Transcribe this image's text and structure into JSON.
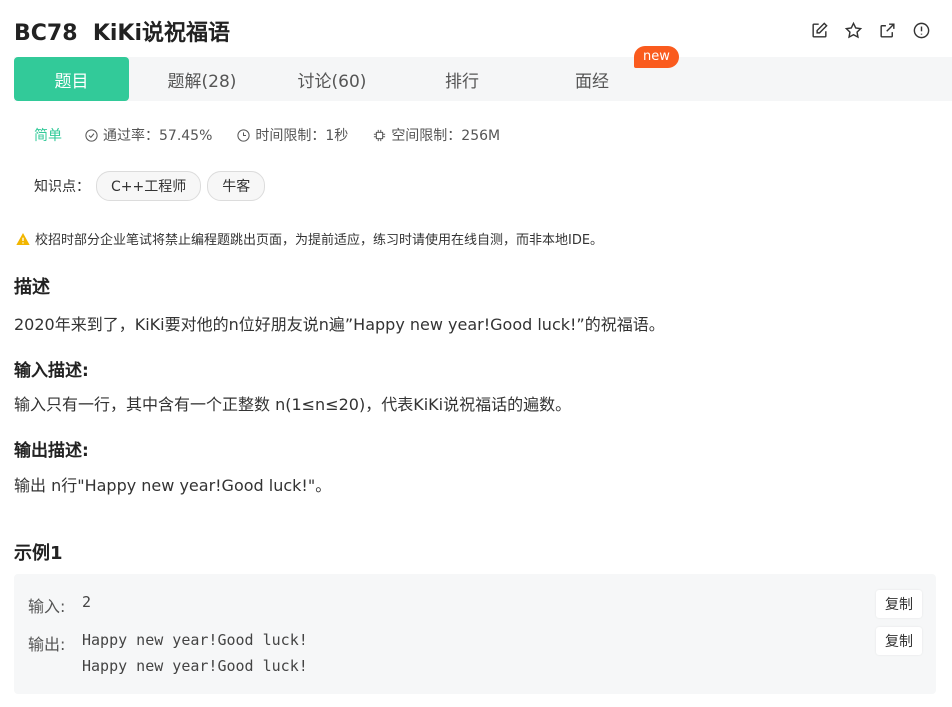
{
  "problem": {
    "id": "BC78",
    "name": "KiKi说祝福语",
    "title_full": "BC78  KiKi说祝福语"
  },
  "title_actions": [
    {
      "icon": "edit-icon"
    },
    {
      "icon": "star-icon"
    },
    {
      "icon": "share-external-icon"
    },
    {
      "icon": "report-icon"
    }
  ],
  "tabs": [
    {
      "label": "题目",
      "active": true
    },
    {
      "label": "题解(28)"
    },
    {
      "label": "讨论(60)"
    },
    {
      "label": "排行"
    },
    {
      "label": "面经"
    }
  ],
  "badge_new": "new",
  "meta": {
    "difficulty": "简单",
    "pass_rate": "通过率：57.45%",
    "time_limit": "时间限制：1秒",
    "memory_limit": "空间限制：256M"
  },
  "knowledge": {
    "label": "知识点：",
    "tags": [
      "C++工程师",
      "牛客"
    ]
  },
  "warning": "校招时部分企业笔试将禁止编程题跳出页面，为提前适应，练习时请使用在线自测，而非本地IDE。",
  "description": {
    "heading": "描述",
    "text": "2020年来到了，KiKi要对他的n位好朋友说n遍”Happy new year!Good luck!”的祝福语。"
  },
  "input_desc": {
    "heading": "输入描述:",
    "text": "输入只有一行，其中含有一个正整数 n(1≤n≤20)，代表KiKi说祝福话的遍数。"
  },
  "output_desc": {
    "heading": "输出描述:",
    "text": "输出 n行\"Happy new year!Good luck!\"。"
  },
  "example": {
    "heading": "示例1",
    "input_label": "输入:",
    "input_value": "2",
    "output_label": "输出:",
    "output_value": "Happy new year!Good luck!\nHappy new year!Good luck!",
    "copy_label": "复制"
  },
  "colors": {
    "accent": "#32ca99",
    "badge": "#fa5b1e",
    "warning_icon": "#f2b600"
  }
}
